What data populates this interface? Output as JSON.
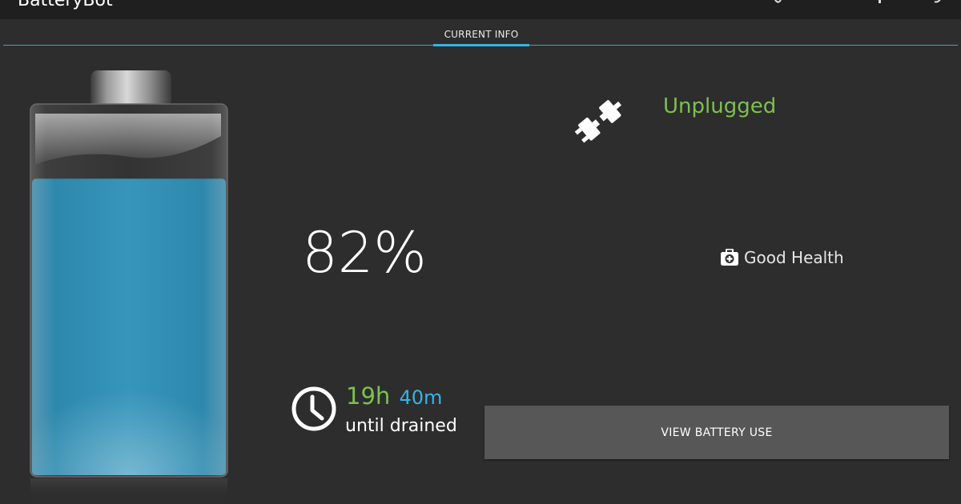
{
  "app": {
    "title": "BatteryBot"
  },
  "tabs": [
    {
      "label": "CURRENT INFO",
      "selected": true
    }
  ],
  "battery": {
    "level_percent": 82,
    "percent_text": "82%",
    "fill_color": "#2f8bb0"
  },
  "time_remaining": {
    "hours_text": "19h",
    "minutes_text": "40m",
    "caption": "until drained"
  },
  "charger": {
    "icon": "unplugged-icon",
    "status": "Unplugged"
  },
  "health": {
    "icon": "first-aid-kit-icon",
    "status": "Good Health"
  },
  "actions": {
    "view_battery_use_label": "VIEW BATTERY USE"
  },
  "colors": {
    "background": "#2d2d2d",
    "accent_blue": "#33b5e5",
    "accent_green": "#7cc14e"
  }
}
